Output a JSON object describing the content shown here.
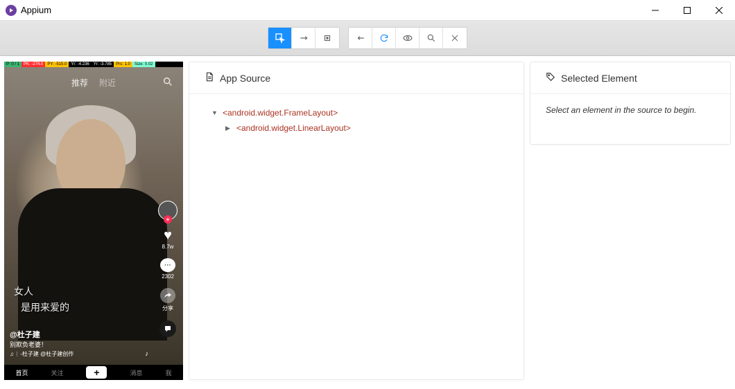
{
  "window": {
    "title": "Appium"
  },
  "toolbar": {
    "select_native_title": "Select Elements",
    "swipe_title": "Swipe By Coordinates",
    "tap_title": "Tap By Coordinates",
    "back_title": "Back",
    "refresh_title": "Refresh Source & Screenshot",
    "recording_title": "Start Recording",
    "search_title": "Search for element",
    "quit_title": "Quit Session"
  },
  "device": {
    "status": {
      "p": "P: 0 / 1",
      "pk": "PK: -274.0",
      "py": "PY: -515.0",
      "yr_a": "Yr: -4.236",
      "yr_b": "Yr: -3.785",
      "prs": "Prs: 1.0",
      "size": "Size: 0.02"
    },
    "top_tabs": {
      "recommend": "推荐",
      "nearby": "附近"
    },
    "captions": {
      "line1": "女人",
      "line2": "是用来爱的"
    },
    "info": {
      "username": "@杜子建",
      "subtitle": "别欺负老婆！",
      "music": "♫  ᛁ -杜子建   @杜子建创作"
    },
    "side": {
      "likes": "8.7w",
      "comments": "2302",
      "share": "分享"
    },
    "nav": {
      "home": "首页",
      "follow": "关注",
      "message": "消息",
      "me": "我"
    }
  },
  "source": {
    "title": "App Source",
    "tree": {
      "root": "<android.widget.FrameLayout>",
      "child1": "<android.widget.LinearLayout>"
    }
  },
  "selected": {
    "title": "Selected Element",
    "empty": "Select an element in the source to begin."
  }
}
